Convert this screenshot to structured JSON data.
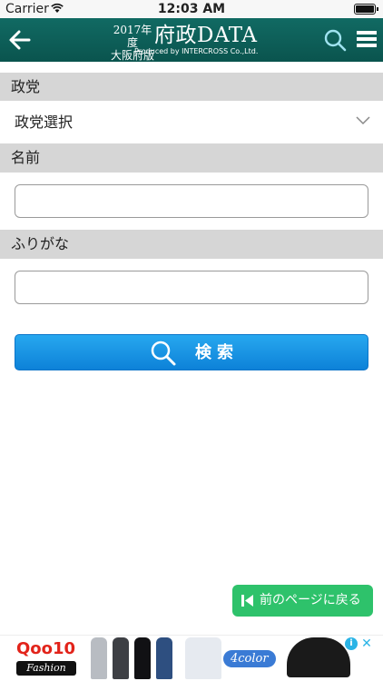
{
  "status_bar": {
    "carrier": "Carrier",
    "time": "12:03 AM"
  },
  "nav_bar": {
    "logo": {
      "year_line1": "2017年度",
      "year_line2": "大阪府版",
      "title": "府政DATA",
      "produced_by": "Produced by INTERCROSS Co.,Ltd."
    }
  },
  "form": {
    "party_label": "政党",
    "party_select_value": "政党選択",
    "name_label": "名前",
    "name_value": "",
    "furigana_label": "ふりがな",
    "furigana_value": "",
    "search_button_label": "検索"
  },
  "prev_button_label": "前のページに戻る",
  "ad": {
    "brand_top": "Qoo10",
    "brand_bottom": "Fashion",
    "tag": "4color",
    "info": "i",
    "close": "✕"
  },
  "colors": {
    "nav_bg": "#0d5f58",
    "section_bg": "#d6d6d6",
    "search_button": "#1a95e4",
    "prev_button": "#2ec26b"
  }
}
